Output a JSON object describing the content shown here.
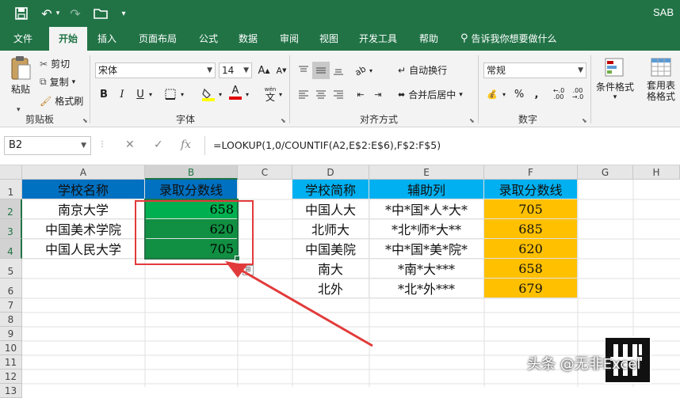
{
  "window": {
    "title": "SAB"
  },
  "menu": [
    "文件",
    "开始",
    "插入",
    "页面布局",
    "公式",
    "数据",
    "审阅",
    "视图",
    "开发工具",
    "帮助",
    "告诉我你想要做什么"
  ],
  "ribbon": {
    "clipboard": {
      "paste": "粘贴",
      "cut": "剪切",
      "copy": "复制",
      "painter": "格式刷",
      "label": "剪贴板"
    },
    "font": {
      "name": "宋体",
      "size": "14",
      "bold": "B",
      "italic": "I",
      "underline": "U",
      "grow": "A",
      "shrink": "A",
      "fontcolor": "A",
      "phonetic": "文",
      "label": "字体"
    },
    "align": {
      "wrap": "自动换行",
      "merge": "合并后居中",
      "label": "对齐方式"
    },
    "number": {
      "format": "常规",
      "percent": "%",
      "comma": ",",
      "label": "数字"
    },
    "styles": {
      "cond": "条件格式",
      "table": "套用表格格式"
    }
  },
  "formula_bar": {
    "name_box": "B2",
    "fx": "fx",
    "formula": "=LOOKUP(1,0/COUNTIF(A2,E$2:E$6),F$2:F$5)"
  },
  "columns": [
    "A",
    "B",
    "C",
    "D",
    "E",
    "F",
    "G",
    "H"
  ],
  "rows": [
    "1",
    "2",
    "3",
    "4",
    "5",
    "6",
    "7",
    "8",
    "9",
    "10",
    "11",
    "12",
    "13"
  ],
  "table1": {
    "header": [
      "学校名称",
      "录取分数线"
    ],
    "rows": [
      [
        "南京大学",
        "658"
      ],
      [
        "中国美术学院",
        "620"
      ],
      [
        "中国人民大学",
        "705"
      ]
    ]
  },
  "table2": {
    "header": [
      "学校简称",
      "辅助列",
      "录取分数线"
    ],
    "rows": [
      [
        "中国人大",
        "*中*国*人*大*",
        "705"
      ],
      [
        "北师大",
        "*北*师*大**",
        "685"
      ],
      [
        "中国美院",
        "*中*国*美*院*",
        "620"
      ],
      [
        "南大",
        "*南*大***",
        "658"
      ],
      [
        "北外",
        "*北*外***",
        "679"
      ]
    ]
  },
  "watermark": "头条 @无非Excel",
  "colors": {
    "excel_green": "#217346",
    "header_blue": "#0070c0",
    "header_cyan": "#00b0f0",
    "gold": "#ffc000",
    "sel_green": "#00b050",
    "sel_dark": "#118f42",
    "arrow_red": "#e23a3a"
  }
}
